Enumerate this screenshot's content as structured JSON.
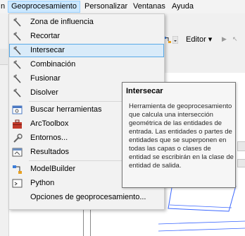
{
  "menubar": {
    "items": [
      {
        "label": "n"
      },
      {
        "label": "Geoprocesamiento"
      },
      {
        "label": "Personalizar"
      },
      {
        "label": "Ventanas"
      },
      {
        "label": "Ayuda"
      }
    ]
  },
  "toolbar": {
    "editor_label": "Editor ▾"
  },
  "menu": {
    "items": [
      {
        "label": "Zona de influencia"
      },
      {
        "label": "Recortar"
      },
      {
        "label": "Intersecar"
      },
      {
        "label": "Combinación"
      },
      {
        "label": "Fusionar"
      },
      {
        "label": "Disolver"
      },
      {
        "label": "Buscar herramientas"
      },
      {
        "label": "ArcToolbox"
      },
      {
        "label": "Entornos..."
      },
      {
        "label": "Resultados"
      },
      {
        "label": "ModelBuilder"
      },
      {
        "label": "Python"
      },
      {
        "label": "Opciones de geoprocesamiento..."
      }
    ]
  },
  "tooltip": {
    "title": "Intersecar",
    "body": "Herramienta de geoprocesamiento que calcula una intersección geométrica de las entidades de entrada. Las entidades o partes de entidades que se superponen en todas las capas o clases de entidad se escribirán en la clase de entidad de salida."
  },
  "colors": {
    "highlight_bg": "#d9ebf9",
    "highlight_border": "#59a9e6",
    "menu_active_bg": "#cce8ff",
    "map_lines": "#3a66ff"
  }
}
